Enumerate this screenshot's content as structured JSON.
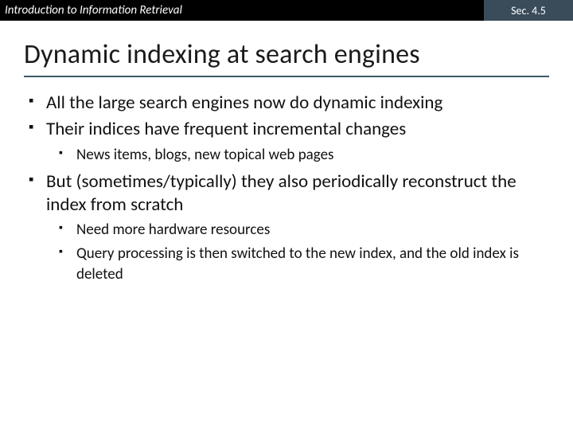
{
  "header": {
    "left": "Introduction to Information Retrieval",
    "right": "Sec. 4.5"
  },
  "title": "Dynamic indexing at search engines",
  "bullets": {
    "b1": "All the large search engines now do dynamic indexing",
    "b2": "Their indices have frequent incremental changes",
    "b2_1": "News items, blogs, new topical web pages",
    "b3": "But (sometimes/typically) they also periodically reconstruct the index from scratch",
    "b3_1": "Need more hardware resources",
    "b3_2": "Query processing is then switched to the new index, and the old index is deleted"
  }
}
